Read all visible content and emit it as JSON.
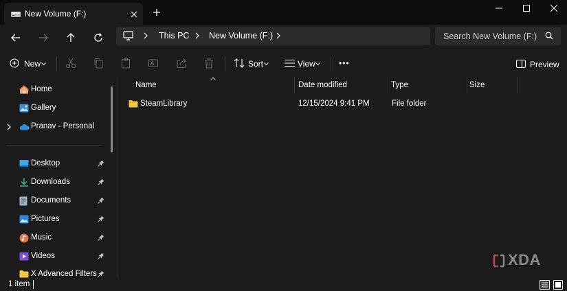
{
  "window": {
    "tab_title": "New Volume (F:)",
    "new_tab_label": "+"
  },
  "address": {
    "crumbs": [
      "This PC",
      "New Volume (F:)"
    ],
    "search_placeholder": "Search New Volume (F:)"
  },
  "toolbar": {
    "new_label": "New",
    "sort_label": "Sort",
    "view_label": "View",
    "more_label": "•••",
    "preview_label": "Preview"
  },
  "sidebar": {
    "top_items": [
      {
        "label": "Home",
        "icon": "home-icon"
      },
      {
        "label": "Gallery",
        "icon": "gallery-icon"
      },
      {
        "label": "Pranav - Personal",
        "icon": "onedrive-icon"
      }
    ],
    "pinned_items": [
      {
        "label": "Desktop",
        "icon": "desktop-folder-icon"
      },
      {
        "label": "Downloads",
        "icon": "downloads-folder-icon"
      },
      {
        "label": "Documents",
        "icon": "documents-folder-icon"
      },
      {
        "label": "Pictures",
        "icon": "pictures-folder-icon"
      },
      {
        "label": "Music",
        "icon": "music-folder-icon"
      },
      {
        "label": "Videos",
        "icon": "videos-folder-icon"
      },
      {
        "label": "X Advanced Filters I U",
        "icon": "folder-icon"
      }
    ]
  },
  "columns": [
    "Name",
    "Date modified",
    "Type",
    "Size"
  ],
  "files": [
    {
      "name": "SteamLibrary",
      "date_modified": "12/15/2024 9:41 PM",
      "type": "File folder",
      "size": ""
    }
  ],
  "status": {
    "item_count": "1 item"
  },
  "watermark": "XDA",
  "colors": {
    "background": "#1c1c1c",
    "titlebar": "#0d0d0d",
    "field": "#2b2b2b",
    "folder": "#f4c542",
    "accent": "#4cc2ff"
  }
}
